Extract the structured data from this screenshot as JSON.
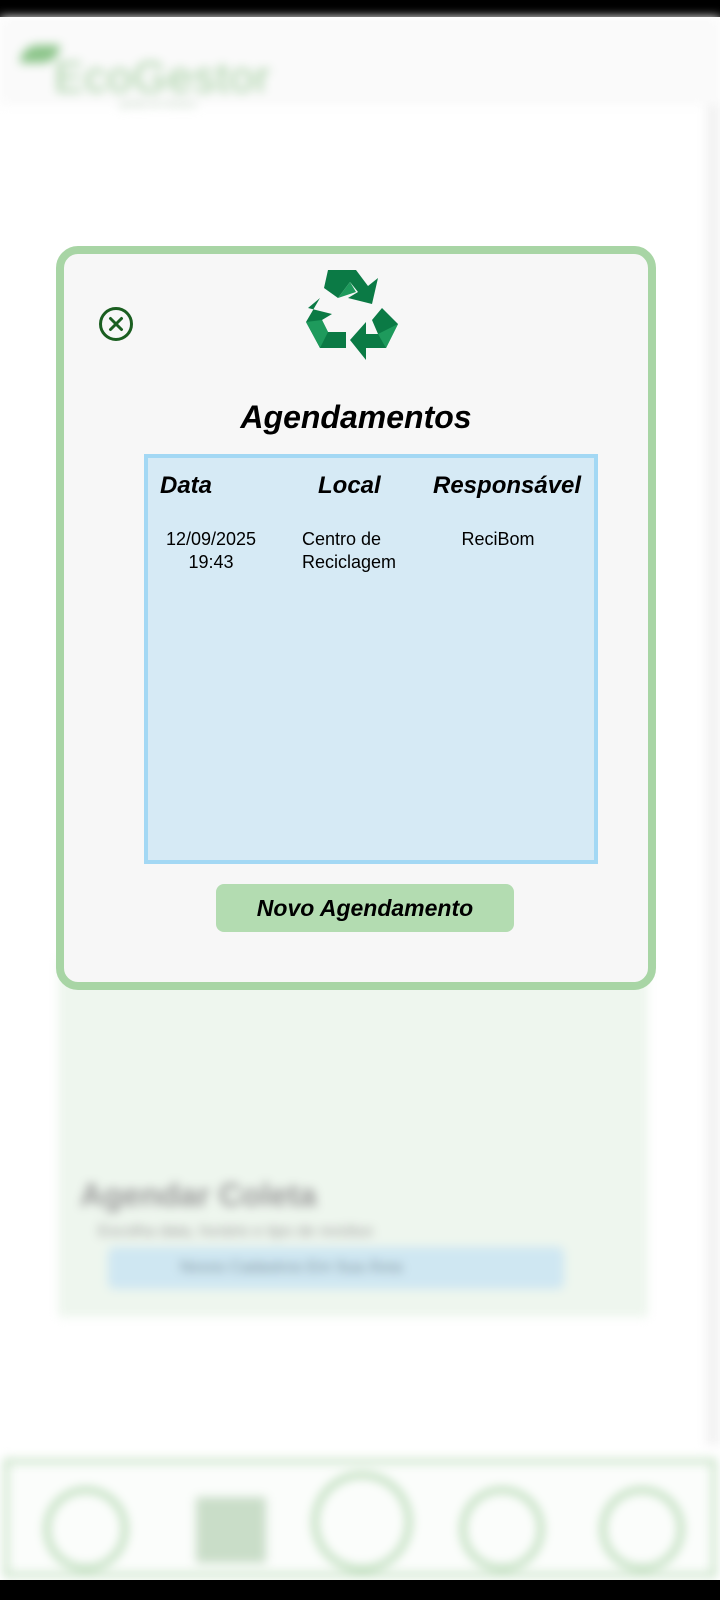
{
  "app": {
    "logo_text": "EcoGestor",
    "logo_subtitle": "gestão de resíduos"
  },
  "background": {
    "card_title": "Agendar Coleta",
    "card_subtitle": "Escolha data, horário e tipo de resíduo",
    "card_button": "Novos Cadastros Em Sua Área"
  },
  "modal": {
    "title": "Agendamentos",
    "headers": {
      "date": "Data",
      "location": "Local",
      "responsible": "Responsável"
    },
    "rows": [
      {
        "date": "12/09/2025",
        "time": "19:43",
        "location_line1": "Centro de",
        "location_line2": "Reciclagem",
        "responsible": "ReciBom"
      }
    ],
    "new_button": "Novo Agendamento"
  },
  "colors": {
    "modal_border": "#a8d5a5",
    "table_bg": "#d6eaf5",
    "table_border": "#a3d8f4",
    "button_bg": "#b3dcb1",
    "recycle_green": "#0b7a45",
    "close_green": "#1a5e20"
  },
  "icons": {
    "close": "close-circle-icon",
    "recycle": "recycle-icon"
  }
}
